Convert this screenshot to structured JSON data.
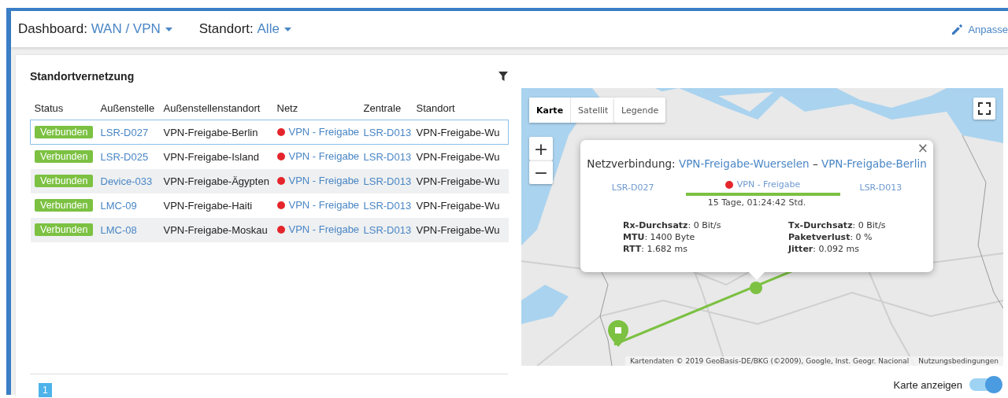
{
  "header": {
    "dashboard_label": "Dashboard:",
    "dashboard_value": "WAN / VPN",
    "location_label": "Standort:",
    "location_value": "Alle",
    "customize": "Anpasse"
  },
  "panel": {
    "title": "Standortvernetzung"
  },
  "table": {
    "columns": [
      "Status",
      "Außenstelle",
      "Außenstellenstandort",
      "Netz",
      "Zentrale",
      "Standort"
    ],
    "rows": [
      {
        "status": "Verbunden",
        "branch": "LSR-D027",
        "branch_site": "VPN-Freigabe-Berlin",
        "network": "VPN - Freigabe",
        "central": "LSR-D013",
        "site": "VPN-Freigabe-Wu",
        "selected": true
      },
      {
        "status": "Verbunden",
        "branch": "LSR-D025",
        "branch_site": "VPN-Freigabe-Island",
        "network": "VPN - Freigabe",
        "central": "LSR-D013",
        "site": "VPN-Freigabe-Wu",
        "selected": false
      },
      {
        "status": "Verbunden",
        "branch": "Device-033",
        "branch_site": "VPN-Freigabe-Ägypten",
        "network": "VPN - Freigabe",
        "central": "LSR-D013",
        "site": "VPN-Freigabe-Wu",
        "selected": false
      },
      {
        "status": "Verbunden",
        "branch": "LMC-09",
        "branch_site": "VPN-Freigabe-Haiti",
        "network": "VPN - Freigabe",
        "central": "LSR-D013",
        "site": "VPN-Freigabe-Wu",
        "selected": false
      },
      {
        "status": "Verbunden",
        "branch": "LMC-08",
        "branch_site": "VPN-Freigabe-Moskau",
        "network": "VPN - Freigabe",
        "central": "LSR-D013",
        "site": "VPN-Freigabe-Wu",
        "selected": false
      }
    ]
  },
  "pagination": {
    "pages": [
      {
        "label": "1",
        "selected": true
      }
    ]
  },
  "map": {
    "map_types": [
      {
        "label": "Karte",
        "selected": true
      },
      {
        "label": "Satellit",
        "selected": false
      }
    ],
    "legend": "Legende",
    "zoom_in": "+",
    "zoom_out": "−",
    "popup": {
      "close": "×",
      "title_label": "Netzverbindung:",
      "from": "VPN-Freigabe-Wuerselen",
      "separator": "–",
      "to": "VPN-Freigabe-Berlin",
      "left_device": "LSR-D027",
      "network": "VPN - Freigabe",
      "right_device": "LSR-D013",
      "uptime": "15 Tage, 01:24:42 Std.",
      "stats": [
        "**Rx-Durchsatz**: 0 Bit/s",
        "**Tx-Durchsatz**: 0 Bit/s",
        "**MTU**: 1400 Byte",
        "**Paketverlust**: 0 %",
        "**RTT**: 1.682 ms",
        "**Jitter**: 0.092 ms"
      ]
    },
    "attribution": "Kartendaten © 2019 GeoBasis-DE/BKG (©2009), Google, Inst. Geogr. Nacional",
    "terms": "Nutzungsbedingungen"
  },
  "map_toggle": {
    "label": "Karte anzeigen",
    "on": true
  }
}
